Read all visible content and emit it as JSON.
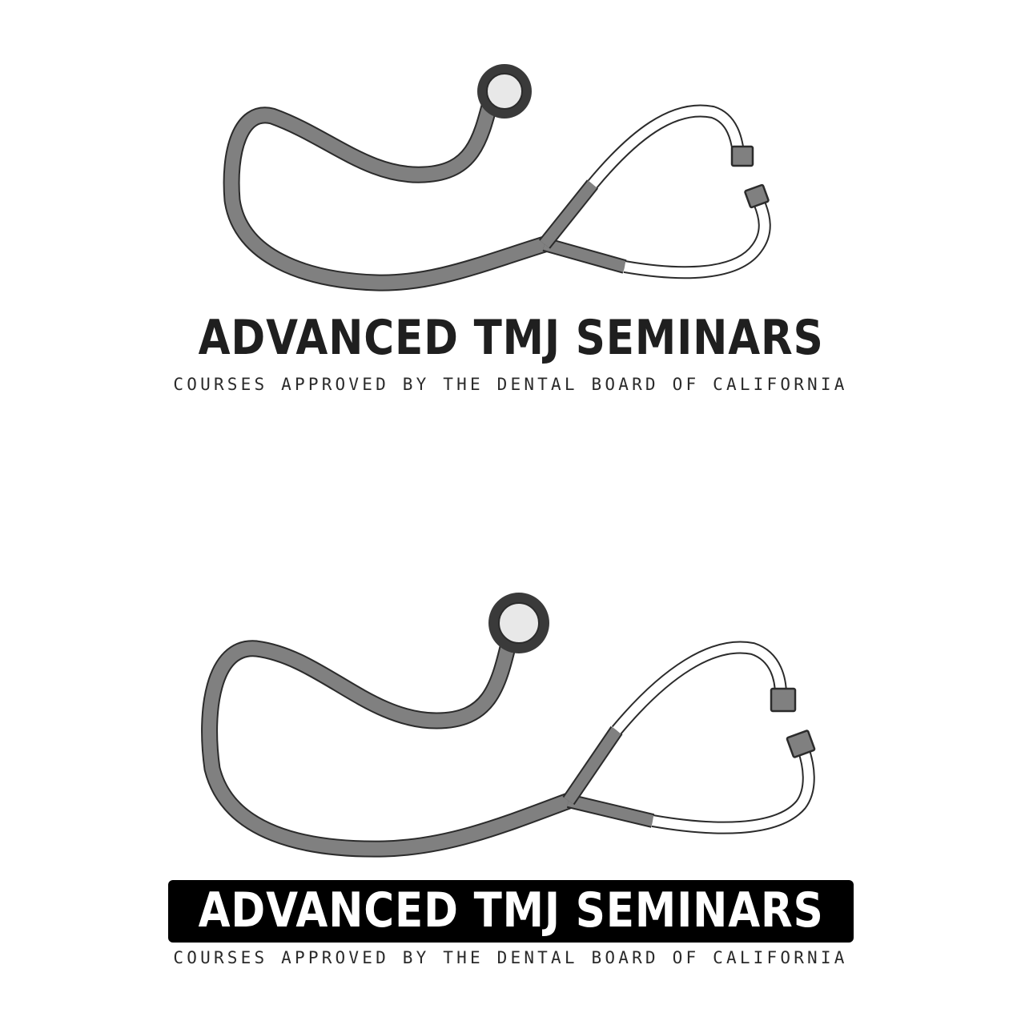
{
  "logos": [
    {
      "variant": "plain-title",
      "title": "ADVANCED TMJ SEMINARS",
      "subtitle": "COURSES APPROVED BY THE DENTAL BOARD OF CALIFORNIA"
    },
    {
      "variant": "boxed-title",
      "title": "ADVANCED TMJ SEMINARS",
      "subtitle": "COURSES APPROVED BY THE DENTAL BOARD OF CALIFORNIA"
    }
  ],
  "colors": {
    "background": "#ffffff",
    "tube": "#808080",
    "outline": "#2b2b2b",
    "chestpiece_ring": "#3a3a3a",
    "chestpiece_face": "#e8e8e8",
    "binaural": "#ffffff",
    "title_text": "#1f1f1f",
    "title_box": "#000000"
  },
  "icons": [
    "stethoscope-icon",
    "stethoscope-icon"
  ]
}
